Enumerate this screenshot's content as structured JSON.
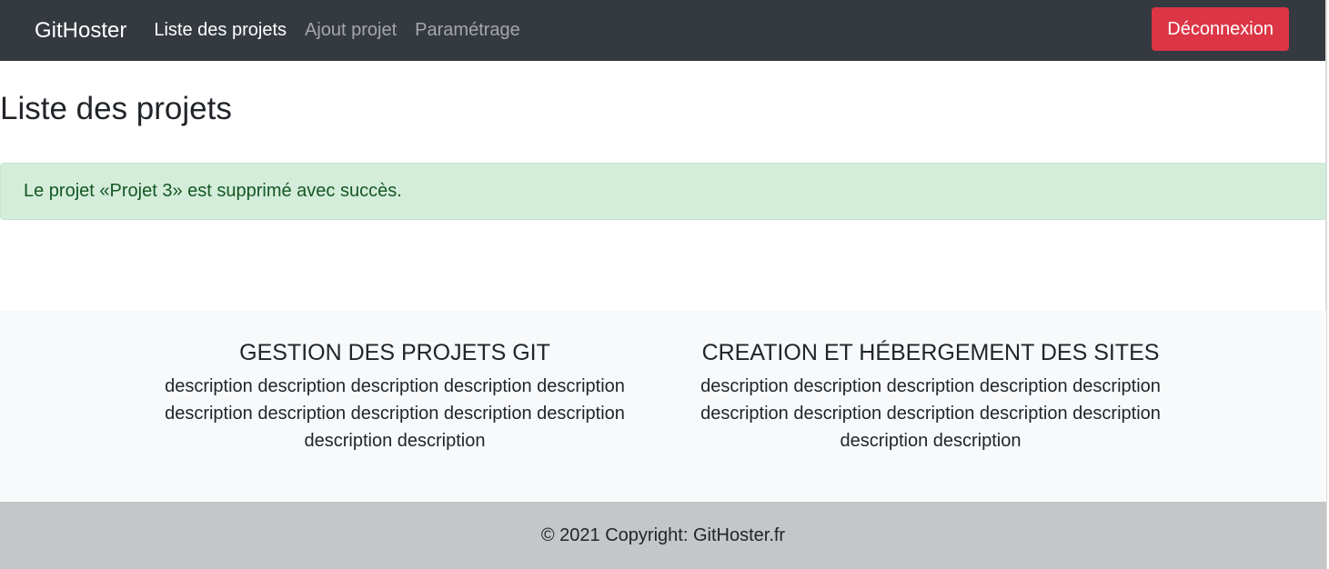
{
  "navbar": {
    "brand": "GitHoster",
    "links": [
      {
        "label": "Liste des projets",
        "active": true
      },
      {
        "label": "Ajout projet",
        "active": false
      },
      {
        "label": "Paramétrage",
        "active": false
      }
    ],
    "logout_label": "Déconnexion"
  },
  "main": {
    "title": "Liste des projets",
    "alert": "Le projet «Projet 3» est supprimé avec succès."
  },
  "features": [
    {
      "title": "GESTION DES PROJETS GIT",
      "description": "description description description description description description description description description description description description"
    },
    {
      "title": "CREATION ET HÉBERGEMENT DES SITES",
      "description": "description description description description description description description description description description description description"
    }
  ],
  "footer": {
    "prefix": "© 2021 Copyright: ",
    "link": "GitHoster.fr"
  },
  "colors": {
    "navbar_bg": "#343a40",
    "danger": "#dc3545",
    "alert_bg": "#d4edda",
    "alert_text": "#155724",
    "features_bg": "#f8f9fa",
    "footer_bg": "#c4c6c8"
  }
}
